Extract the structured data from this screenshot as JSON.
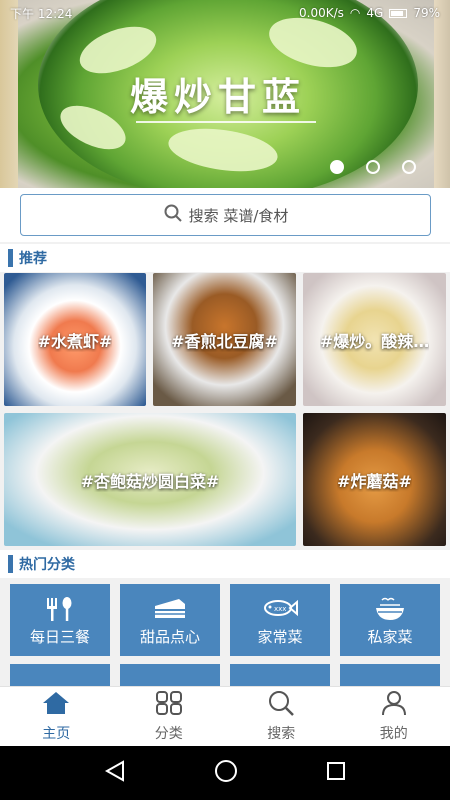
{
  "status_bar": {
    "time": "下午 12:24",
    "network_speed": "0.00K/s",
    "signal": "4G",
    "battery": "79%"
  },
  "banner": {
    "title": "爆炒甘蓝",
    "slide_count": 3,
    "active_slide": 1
  },
  "search": {
    "placeholder": "搜索 菜谱/食材"
  },
  "recommend": {
    "title": "推荐",
    "items": [
      {
        "label": "#水煮虾#"
      },
      {
        "label": "#香煎北豆腐#"
      },
      {
        "label": "#爆炒。酸辣…"
      },
      {
        "label": "#杏鲍菇炒圆白菜#"
      },
      {
        "label": "#炸蘑菇#"
      }
    ]
  },
  "categories": {
    "title": "热门分类",
    "items": [
      {
        "label": "每日三餐",
        "icon": "fork-spoon-icon"
      },
      {
        "label": "甜品点心",
        "icon": "cake-icon"
      },
      {
        "label": "家常菜",
        "icon": "fish-icon"
      },
      {
        "label": "私家菜",
        "icon": "noodle-bowl-icon"
      }
    ]
  },
  "tabbar": {
    "items": [
      {
        "label": "主页",
        "icon": "home-icon",
        "active": true
      },
      {
        "label": "分类",
        "icon": "grid-icon",
        "active": false
      },
      {
        "label": "搜索",
        "icon": "search-icon",
        "active": false
      },
      {
        "label": "我的",
        "icon": "user-icon",
        "active": false
      }
    ]
  },
  "colors": {
    "accent": "#2f6aa3",
    "tile": "#4a86bd",
    "search_border": "#6a9bc6"
  }
}
